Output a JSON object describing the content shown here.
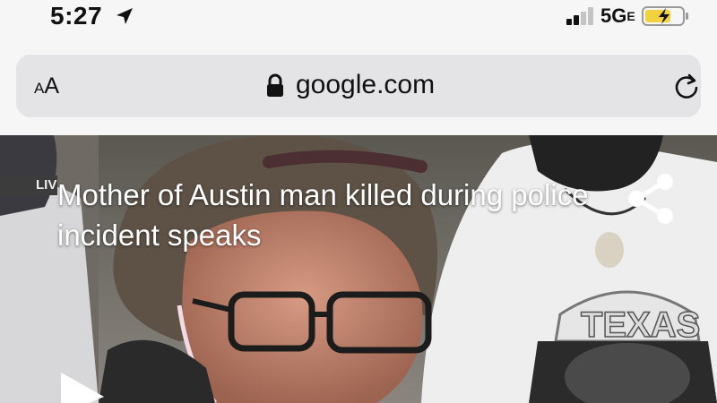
{
  "status_bar": {
    "time": "5:27",
    "network": "5G",
    "network_suffix": "E",
    "icons": [
      "location-arrow-icon",
      "signal-bars-icon",
      "battery-charging-icon"
    ]
  },
  "address_bar": {
    "text_size_small": "A",
    "text_size_big": "A",
    "url": "google.com",
    "icons": [
      "lock-icon",
      "reload-icon"
    ]
  },
  "video": {
    "live_label": "LIV",
    "headline": "Mother of Austin man killed during police incident speaks",
    "shirt_text": "TEXAS",
    "icons": [
      "share-icon",
      "play-icon"
    ]
  },
  "colors": {
    "chrome_background": "#f6f6f6",
    "address_bar_background": "#e4e4e6",
    "headline_text": "#ffffff",
    "battery_fill": "#f2d23c"
  }
}
